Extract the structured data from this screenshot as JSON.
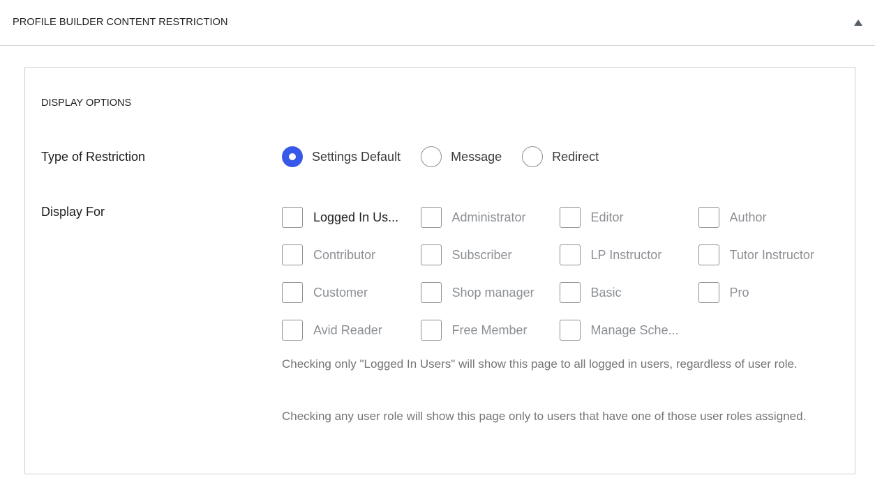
{
  "panel": {
    "title": "PROFILE BUILDER CONTENT RESTRICTION",
    "toggle_icon": "triangle-up-icon",
    "expanded": true
  },
  "section": {
    "title": "DISPLAY OPTIONS"
  },
  "restriction": {
    "label": "Type of Restriction",
    "options": [
      {
        "label": "Settings Default",
        "checked": true
      },
      {
        "label": "Message",
        "checked": false
      },
      {
        "label": "Redirect",
        "checked": false
      }
    ]
  },
  "display_for": {
    "label": "Display For",
    "options": [
      {
        "label": "Logged In Us...",
        "checked": false,
        "primary": true
      },
      {
        "label": "Administrator",
        "checked": false
      },
      {
        "label": "Editor",
        "checked": false
      },
      {
        "label": "Author",
        "checked": false
      },
      {
        "label": "Contributor",
        "checked": false
      },
      {
        "label": "Subscriber",
        "checked": false
      },
      {
        "label": "LP Instructor",
        "checked": false
      },
      {
        "label": "Tutor Instructor",
        "checked": false
      },
      {
        "label": "Customer",
        "checked": false
      },
      {
        "label": "Shop manager",
        "checked": false
      },
      {
        "label": "Basic",
        "checked": false
      },
      {
        "label": "Pro",
        "checked": false
      },
      {
        "label": "Avid Reader",
        "checked": false
      },
      {
        "label": "Free Member",
        "checked": false
      },
      {
        "label": "Manage Sche...",
        "checked": false
      }
    ],
    "help": [
      "Checking only \"Logged In Users\" will show this page to all logged in users, regardless of user role.",
      "Checking any user role will show this page only to users that have one of those user roles assigned."
    ]
  },
  "colors": {
    "accent": "#3858e9",
    "border": "#8c8f94",
    "muted_text": "#8c8f94",
    "help_text": "#757575"
  }
}
